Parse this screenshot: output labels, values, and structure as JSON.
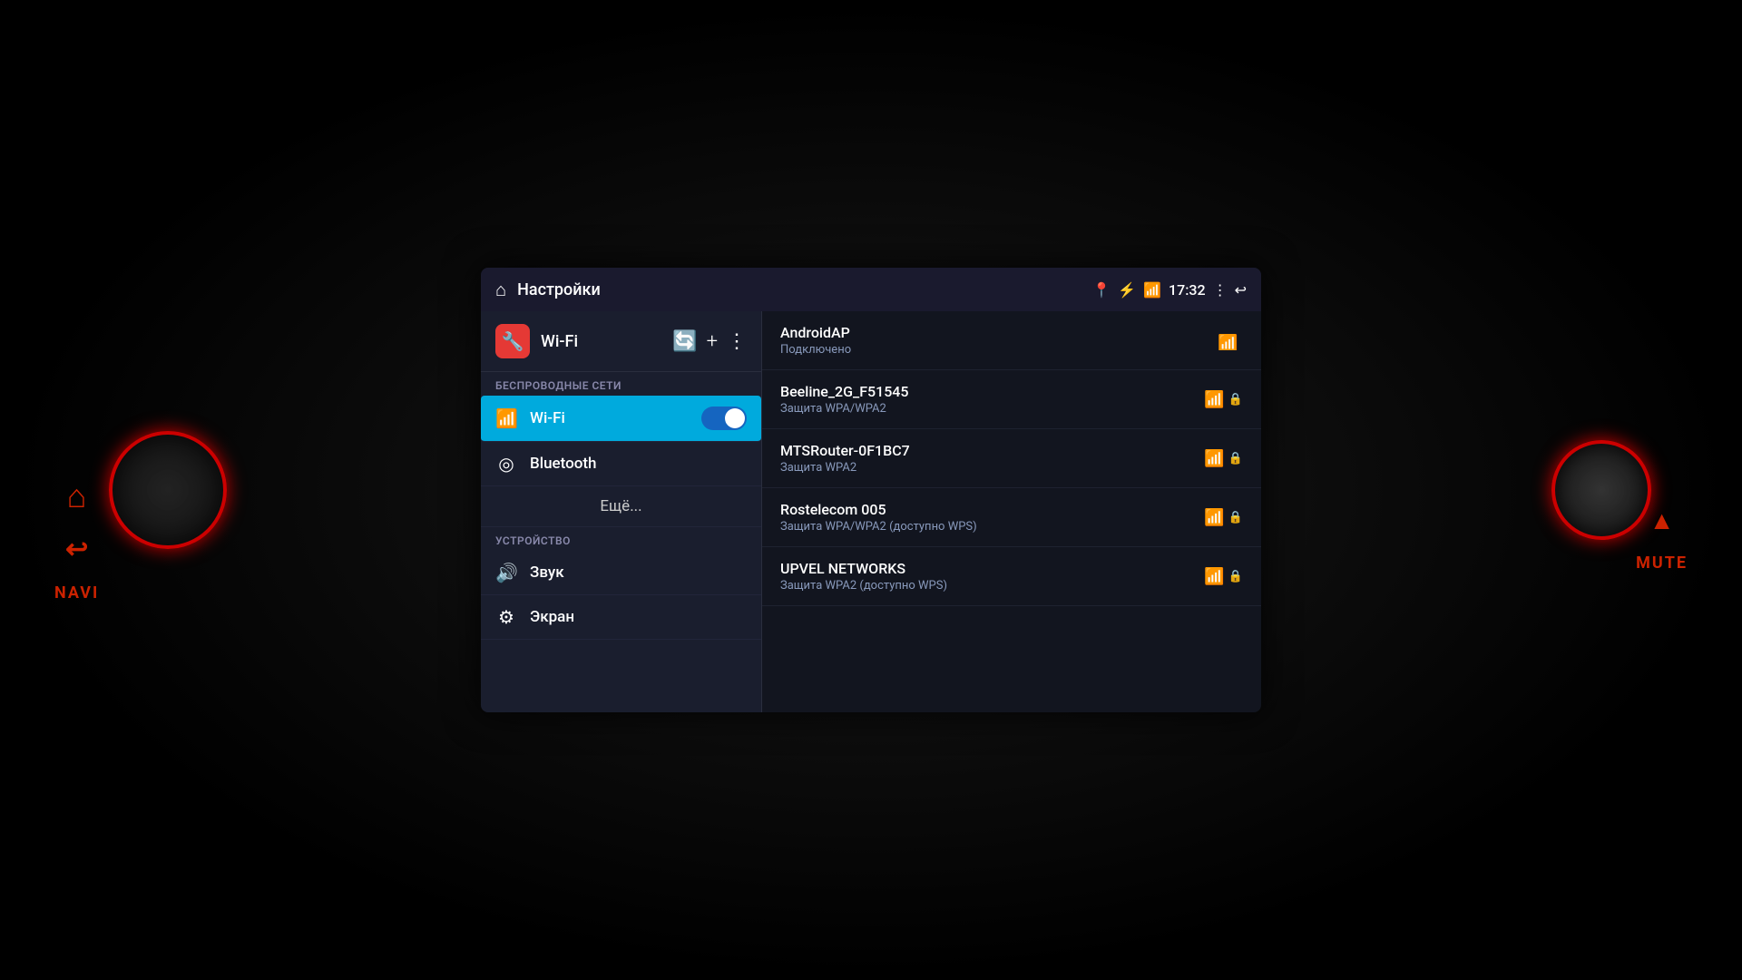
{
  "dashboard": {
    "background_color": "#000000"
  },
  "status_bar": {
    "title": "Настройки",
    "time": "17:32",
    "home_icon": "⌂"
  },
  "wifi_section": {
    "label": "Wi-Fi",
    "section_title": "БЕСПРОВОДНЫЕ СЕТИ"
  },
  "device_section": {
    "section_title": "УСТРОЙСТВО"
  },
  "nav_items": [
    {
      "id": "wifi",
      "label": "Wi-Fi",
      "active": true
    },
    {
      "id": "bluetooth",
      "label": "Bluetooth",
      "active": false
    },
    {
      "id": "more",
      "label": "Ещё...",
      "active": false
    },
    {
      "id": "sound",
      "label": "Звук",
      "active": false
    },
    {
      "id": "screen",
      "label": "Экран",
      "active": false
    }
  ],
  "networks": [
    {
      "name": "AndroidAP",
      "status": "Подключено",
      "locked": false,
      "connected": true
    },
    {
      "name": "Beeline_2G_F51545",
      "status": "Защита WPA/WPA2",
      "locked": true
    },
    {
      "name": "MTSRouter-0F1BC7",
      "status": "Защита WPA2",
      "locked": true
    },
    {
      "name": "Rostelecom 005",
      "status": "Защита WPA/WPA2 (доступно WPS)",
      "locked": true
    },
    {
      "name": "UPVEL NETWORKS",
      "status": "Защита WPA2 (доступно WPS)",
      "locked": true
    }
  ],
  "buttons": {
    "left": {
      "home": "⌂",
      "back": "↩",
      "navi": "NAVI"
    },
    "right": {
      "mute": "MUTE",
      "triangle": "▲"
    }
  }
}
